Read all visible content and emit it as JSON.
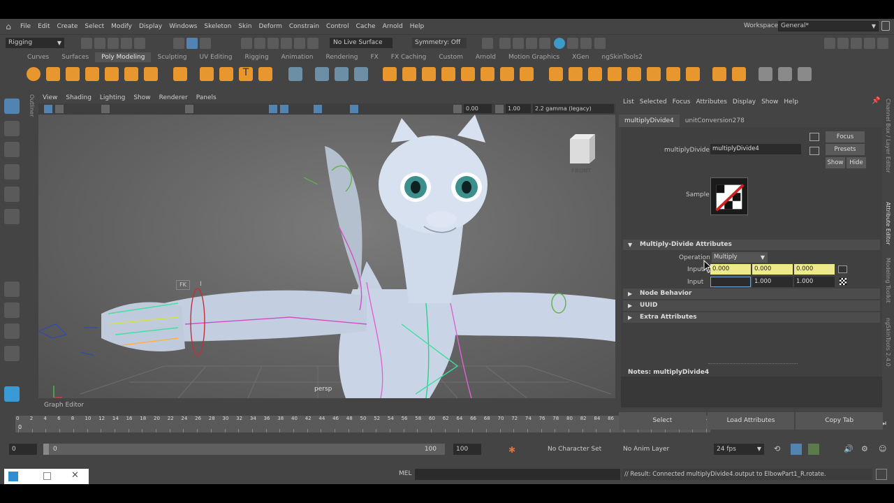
{
  "menubar": {
    "items": [
      "File",
      "Edit",
      "Create",
      "Select",
      "Modify",
      "Display",
      "Windows",
      "Skeleton",
      "Skin",
      "Deform",
      "Constrain",
      "Control",
      "Cache",
      "Arnold",
      "Help"
    ],
    "workspace_label": "Workspace:",
    "workspace_value": "General*"
  },
  "status": {
    "mode": "Rigging",
    "live_surface": "No Live Surface",
    "symmetry": "Symmetry: Off"
  },
  "shelf": {
    "tabs": [
      "Curves",
      "Surfaces",
      "Poly Modeling",
      "Sculpting",
      "UV Editing",
      "Rigging",
      "Animation",
      "Rendering",
      "FX",
      "FX Caching",
      "Custom",
      "Arnold",
      "Motion Graphics",
      "XGen",
      "ngSkinTools2"
    ],
    "active_tab": "Poly Modeling"
  },
  "side": {
    "outliner": "Outliner",
    "tabs": [
      "Channel Box / Layer Editor",
      "Attribute Editor",
      "Modeling Toolkit",
      "ngSkinTools 2.4.0"
    ]
  },
  "viewport": {
    "menu": [
      "View",
      "Shading",
      "Lighting",
      "Show",
      "Renderer",
      "Panels"
    ],
    "exposure": "0.00",
    "gamma_value": "1.00",
    "color_space": "2.2 gamma (legacy)",
    "camera": "persp",
    "view_cube": "FRONT",
    "fk_label": "FK",
    "ik_label": "I"
  },
  "graph_editor": {
    "label": "Graph Editor"
  },
  "timeline": {
    "ticks": [
      "0",
      "2",
      "4",
      "6",
      "8",
      "10",
      "12",
      "14",
      "16",
      "18",
      "20",
      "22",
      "24",
      "26",
      "28",
      "30",
      "32",
      "34",
      "36",
      "38",
      "40",
      "42",
      "44",
      "46",
      "48",
      "50",
      "52",
      "54",
      "56",
      "58",
      "60",
      "62",
      "64",
      "66",
      "68",
      "70",
      "72",
      "74",
      "76",
      "78",
      "80",
      "82",
      "84",
      "86",
      "88",
      "90",
      "92",
      "94",
      "96",
      "98",
      "100"
    ],
    "current_frame": "0",
    "start_marker": "0"
  },
  "range": {
    "start": "0",
    "inner_start": "0",
    "inner_end": "100",
    "end": "100",
    "character_set": "No Character Set",
    "anim_layer": "No Anim Layer",
    "fps": "24 fps"
  },
  "cmdline": {
    "label": "MEL",
    "result": "// Result: Connected multiplyDivide4.output to ElbowPart1_R.rotate."
  },
  "attribute_editor": {
    "menu": [
      "List",
      "Selected",
      "Focus",
      "Attributes",
      "Display",
      "Show",
      "Help"
    ],
    "tabs": [
      "multiplyDivide4",
      "unitConversion278"
    ],
    "node_type_label": "multiplyDivide:",
    "node_name": "multiplyDivide4",
    "focus_button": "Focus",
    "presets_button": "Presets",
    "show_button": "Show",
    "hide_button": "Hide",
    "sample_label": "Sample",
    "sections": {
      "md_attrs": "Multiply-Divide Attributes",
      "node_behavior": "Node Behavior",
      "uuid": "UUID",
      "extra": "Extra Attributes"
    },
    "operation_label": "Operation",
    "operation_value": "Multiply",
    "input1_label": "Input 1",
    "input1": [
      "0.000",
      "0.000",
      "0.000"
    ],
    "input2_label": "Input",
    "input2": [
      "",
      "1.000",
      "1.000"
    ],
    "notes_label": "Notes:  multiplyDivide4",
    "bottom_buttons": [
      "Select",
      "Load Attributes",
      "Copy Tab"
    ]
  },
  "colors": {
    "panel_bg": "#444444",
    "field_bg": "#2b2b2b",
    "connected_field": "#eee98a",
    "accent_blue": "#5284b3"
  }
}
